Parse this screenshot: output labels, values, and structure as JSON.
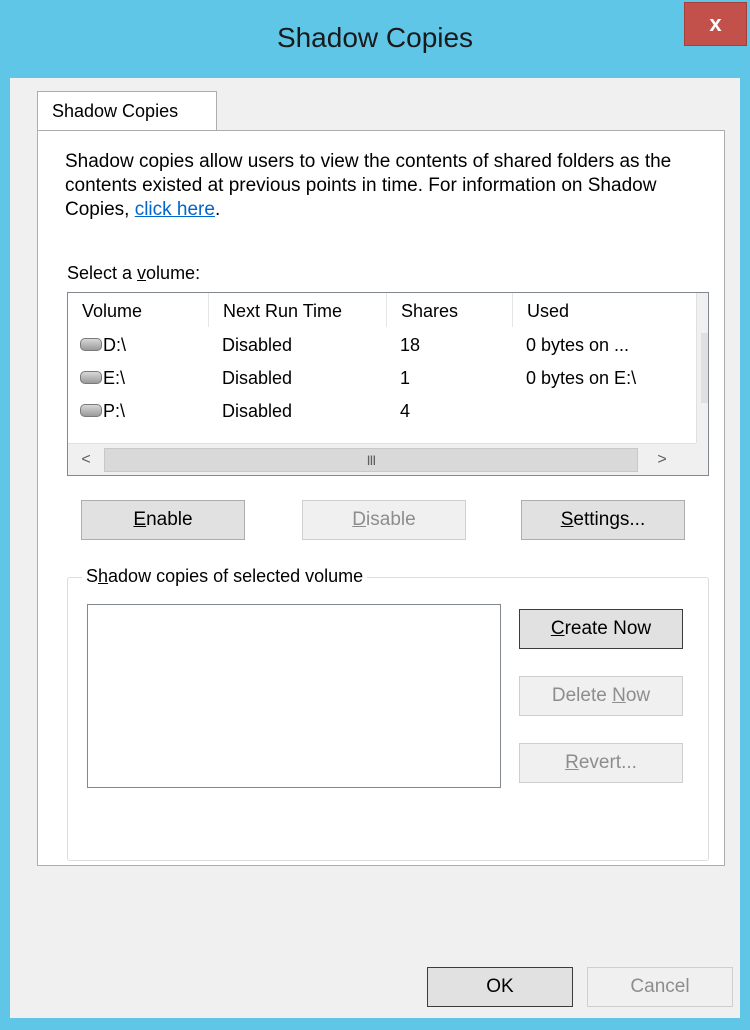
{
  "window": {
    "title": "Shadow Copies",
    "close_label": "x"
  },
  "tabs": [
    {
      "label": "Shadow Copies"
    }
  ],
  "description": {
    "text": "Shadow copies allow users to view the contents of shared folders as the contents existed at previous points in time. For information on Shadow Copies, ",
    "link_text": "click here",
    "suffix": "."
  },
  "volume_section": {
    "label_prefix": "Select a ",
    "label_accel": "v",
    "label_suffix": "olume:",
    "columns": [
      "Volume",
      "Next Run Time",
      "Shares",
      "Used"
    ],
    "rows": [
      {
        "volume": "D:\\",
        "next_run": "Disabled",
        "shares": "18",
        "used": "0 bytes on ..."
      },
      {
        "volume": "E:\\",
        "next_run": "Disabled",
        "shares": "1",
        "used": "0 bytes on E:\\"
      },
      {
        "volume": "P:\\",
        "next_run": "Disabled",
        "shares": "4",
        "used": ""
      }
    ],
    "scroll_up": "^",
    "scroll_down": "v",
    "scroll_thumb": "≡",
    "scroll_left": "<",
    "scroll_right": ">",
    "h_thumb": "III"
  },
  "buttons": {
    "enable": {
      "accel": "E",
      "rest": "nable"
    },
    "disable": {
      "accel": "D",
      "rest": "isable"
    },
    "settings": {
      "accel": "S",
      "rest": "ettings..."
    }
  },
  "shadow_group": {
    "legend_prefix": "S",
    "legend_accel": "h",
    "legend_suffix": "adow copies of selected volume",
    "create_now": {
      "accel": "C",
      "rest": "reate Now"
    },
    "delete_now": {
      "pre": "Delete ",
      "accel": "N",
      "rest": "ow"
    },
    "revert": {
      "accel": "R",
      "rest": "evert..."
    }
  },
  "footer": {
    "ok": "OK",
    "cancel": "Cancel"
  }
}
